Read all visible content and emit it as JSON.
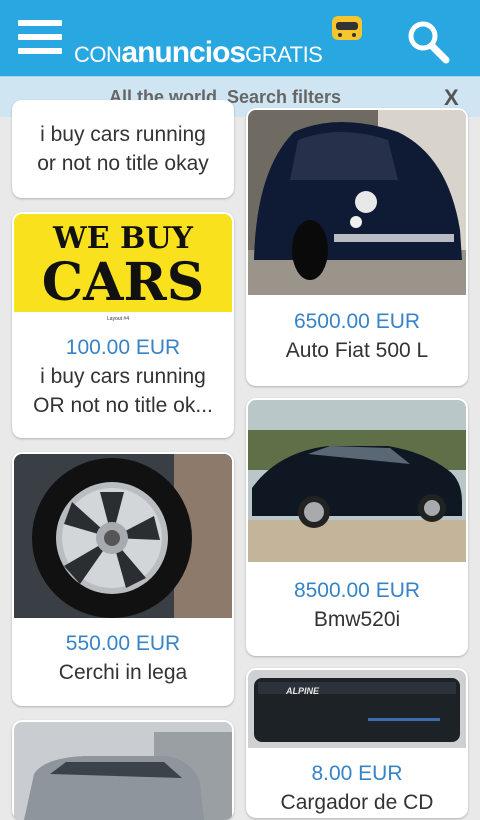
{
  "header": {
    "logo": {
      "con": "CON",
      "main": "anuncios",
      "gratis": "GRATIS"
    },
    "menu_icon": "hamburger-menu-icon",
    "search_icon": "magnifier-icon",
    "bg_color": "#29a7e1"
  },
  "filter_bar": {
    "text": "All the world, Search filters",
    "close_label": "X",
    "bg_color": "#cfe6f2"
  },
  "listings": {
    "left": [
      {
        "price": "",
        "title_line1": "i buy cars running",
        "title_line2": "or not no title okay"
      },
      {
        "image_text": {
          "line1": "WE BUY",
          "line2": "CARS",
          "small": "Layout #4"
        },
        "price": "100.00 EUR",
        "title_line1": "i buy cars running",
        "title_line2": "OR not no title ok..."
      },
      {
        "price": "550.00 EUR",
        "title_line1": "Cerchi in lega"
      },
      {
        "price": ""
      }
    ],
    "right": [
      {
        "price": "6500.00 EUR",
        "title_line1": "Auto Fiat 500 L"
      },
      {
        "price": "8500.00 EUR",
        "title_line1": "Bmw520i"
      },
      {
        "image_text": {
          "brand": "ALPINE"
        },
        "price": "8.00 EUR",
        "title_line1": "Cargador de CD"
      }
    ]
  },
  "colors": {
    "price": "#3783c7",
    "background": "#e9e9e9"
  }
}
